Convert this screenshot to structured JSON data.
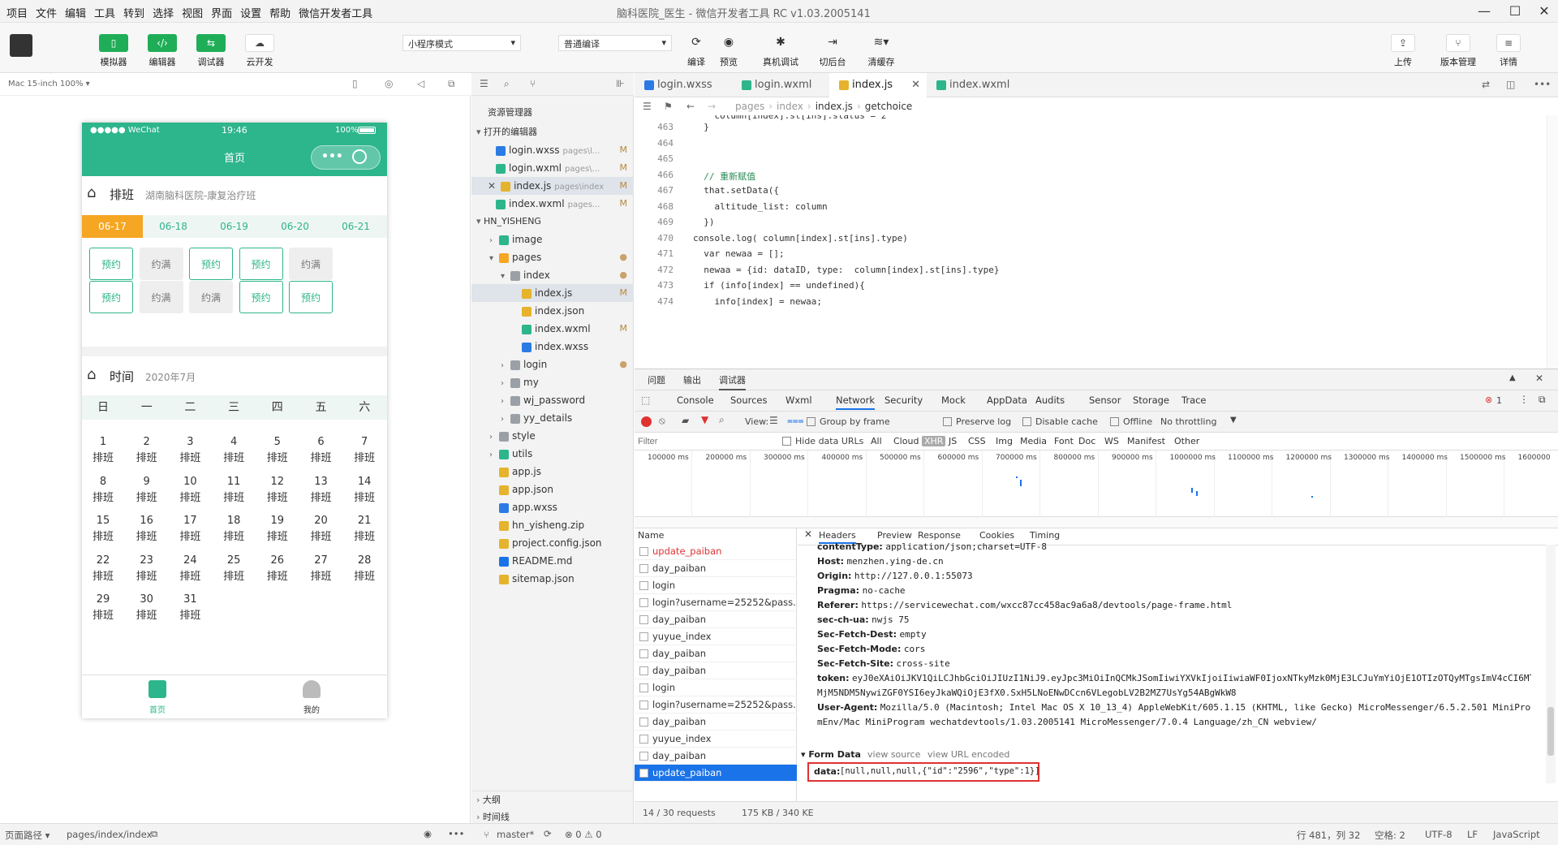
{
  "menus": [
    "项目",
    "文件",
    "编辑",
    "工具",
    "转到",
    "选择",
    "视图",
    "界面",
    "设置",
    "帮助",
    "微信开发者工具"
  ],
  "window_title": "脑科医院_医生 - 微信开发者工具 RC v1.03.2005141",
  "toolbar": {
    "simulator": "模拟器",
    "editor": "编辑器",
    "debugger": "调试器",
    "cloud": "云开发",
    "mode_select": "小程序模式",
    "compile_select": "普通编译",
    "compile": "编译",
    "preview": "预览",
    "real_debug": "真机调试",
    "background": "切后台",
    "clear_cache": "清缓存",
    "upload": "上传",
    "version": "版本管理",
    "details": "详情"
  },
  "sim": {
    "device": "Mac 15-inch 100% ▾",
    "status_carrier": "●●●●● WeChat",
    "status_time": "19:46",
    "status_battery": "100%",
    "nav_title": "首页",
    "section1_title": "排班",
    "section1_sub": "湖南脑科医院-康复治疗班",
    "dates": [
      "06-17",
      "06-18",
      "06-19",
      "06-20",
      "06-21"
    ],
    "slots_row1": [
      "预约",
      "约满",
      "预约",
      "预约",
      "约满"
    ],
    "slots_row2": [
      "预约",
      "约满",
      "约满",
      "预约",
      "预约"
    ],
    "section2_title": "时间",
    "section2_sub": "2020年7月",
    "weekdays": [
      "日",
      "一",
      "二",
      "三",
      "四",
      "五",
      "六"
    ],
    "days": [
      "1",
      "2",
      "3",
      "4",
      "5",
      "6",
      "7",
      "8",
      "9",
      "10",
      "11",
      "12",
      "13",
      "14",
      "15",
      "16",
      "17",
      "18",
      "19",
      "20",
      "21",
      "22",
      "23",
      "24",
      "25",
      "26",
      "27",
      "28",
      "29",
      "30",
      "31"
    ],
    "day_label": "排班",
    "tab_home": "首页",
    "tab_mine": "我的"
  },
  "explorer": {
    "title": "资源管理器",
    "open_editors": "打开的编辑器",
    "open_files": [
      {
        "name": "login.wxss",
        "path": "pages\\l...",
        "mod": "M",
        "color": "#2c7be5"
      },
      {
        "name": "login.wxml",
        "path": "pages\\...",
        "mod": "M",
        "color": "#2db58b"
      },
      {
        "name": "index.js",
        "path": "pages\\index",
        "mod": "M",
        "color": "#e5b32c"
      },
      {
        "name": "index.wxml",
        "path": "pages...",
        "mod": "M",
        "color": "#2db58b"
      }
    ],
    "project": "HN_YISHENG",
    "tree": [
      {
        "name": "image",
        "indent": 1,
        "type": "folder-green"
      },
      {
        "name": "pages",
        "indent": 1,
        "type": "folder-orange",
        "dot": "●"
      },
      {
        "name": "index",
        "indent": 2,
        "type": "folder",
        "dot": "●"
      },
      {
        "name": "index.js",
        "indent": 3,
        "type": "js",
        "mod": "M"
      },
      {
        "name": "index.json",
        "indent": 3,
        "type": "json"
      },
      {
        "name": "index.wxml",
        "indent": 3,
        "type": "wxml",
        "mod": "M"
      },
      {
        "name": "index.wxss",
        "indent": 3,
        "type": "wxss"
      },
      {
        "name": "login",
        "indent": 2,
        "type": "folder",
        "dot": "●"
      },
      {
        "name": "my",
        "indent": 2,
        "type": "folder"
      },
      {
        "name": "wj_password",
        "indent": 2,
        "type": "folder"
      },
      {
        "name": "yy_details",
        "indent": 2,
        "type": "folder"
      },
      {
        "name": "style",
        "indent": 1,
        "type": "folder"
      },
      {
        "name": "utils",
        "indent": 1,
        "type": "folder-green"
      },
      {
        "name": "app.js",
        "indent": 1,
        "type": "js"
      },
      {
        "name": "app.json",
        "indent": 1,
        "type": "json"
      },
      {
        "name": "app.wxss",
        "indent": 1,
        "type": "wxss"
      },
      {
        "name": "hn_yisheng.zip",
        "indent": 1,
        "type": "zip"
      },
      {
        "name": "project.config.json",
        "indent": 1,
        "type": "json"
      },
      {
        "name": "README.md",
        "indent": 1,
        "type": "md"
      },
      {
        "name": "sitemap.json",
        "indent": 1,
        "type": "json"
      }
    ],
    "outline": "大纲",
    "timeline": "时间线"
  },
  "editor": {
    "tabs": [
      "login.wxss",
      "login.wxml",
      "index.js",
      "index.wxml"
    ],
    "breadcrumb": [
      "pages",
      "index",
      "index.js",
      "getchoice"
    ],
    "lines": [
      {
        "n": "463",
        "t": "  }"
      },
      {
        "n": "464",
        "t": ""
      },
      {
        "n": "465",
        "t": ""
      },
      {
        "n": "466",
        "t": "  // 重新赋值"
      },
      {
        "n": "467",
        "t": "  that.setData({"
      },
      {
        "n": "468",
        "t": "    altitude_list: column"
      },
      {
        "n": "469",
        "t": "  })"
      },
      {
        "n": "470",
        "t": "console.log( column[index].st[ins].type)"
      },
      {
        "n": "471",
        "t": "  var newaa = [];"
      },
      {
        "n": "472",
        "t": "  newaa = {id: dataID, type:  column[index].st[ins].type}"
      },
      {
        "n": "473",
        "t": "  if (info[index] == undefined){"
      },
      {
        "n": "474",
        "t": "    info[index] = newaa;"
      }
    ]
  },
  "devtools": {
    "top_tabs": [
      "问题",
      "输出",
      "调试器"
    ],
    "tabs": [
      "Console",
      "Sources",
      "Wxml",
      "Network",
      "Security",
      "Mock",
      "AppData",
      "Audits",
      "Sensor",
      "Storage",
      "Trace"
    ],
    "error_count": "1",
    "view_label": "View:",
    "group_by_frame": "Group by frame",
    "preserve_log": "Preserve log",
    "disable_cache": "Disable cache",
    "offline": "Offline",
    "throttling": "No throttling",
    "filter_placeholder": "Filter",
    "hide_data_urls": "Hide data URLs",
    "type_filters": [
      "All",
      "Cloud",
      "XHR",
      "JS",
      "CSS",
      "Img",
      "Media",
      "Font",
      "Doc",
      "WS",
      "Manifest",
      "Other"
    ],
    "timeline_ticks": [
      "100000 ms",
      "200000 ms",
      "300000 ms",
      "400000 ms",
      "500000 ms",
      "600000 ms",
      "700000 ms",
      "800000 ms",
      "900000 ms",
      "1000000 ms",
      "1100000 ms",
      "1200000 ms",
      "1300000 ms",
      "1400000 ms",
      "1500000 ms",
      "1600000"
    ],
    "name_header": "Name",
    "requests": [
      "update_paiban",
      "day_paiban",
      "login",
      "login?username=25252&pass...",
      "day_paiban",
      "yuyue_index",
      "day_paiban",
      "day_paiban",
      "login",
      "login?username=25252&pass...",
      "day_paiban",
      "yuyue_index",
      "day_paiban",
      "update_paiban"
    ],
    "detail_tabs": [
      "Headers",
      "Preview",
      "Response",
      "Cookies",
      "Timing"
    ],
    "headers": [
      {
        "k": "contentType:",
        "v": "application/json;charset=UTF-8"
      },
      {
        "k": "Host:",
        "v": "menzhen.ying-de.cn"
      },
      {
        "k": "Origin:",
        "v": "http://127.0.0.1:55073"
      },
      {
        "k": "Pragma:",
        "v": "no-cache"
      },
      {
        "k": "Referer:",
        "v": "https://servicewechat.com/wxcc87cc458ac9a6a8/devtools/page-frame.html"
      },
      {
        "k": "sec-ch-ua:",
        "v": "nwjs 75"
      },
      {
        "k": "Sec-Fetch-Dest:",
        "v": "empty"
      },
      {
        "k": "Sec-Fetch-Mode:",
        "v": "cors"
      },
      {
        "k": "Sec-Fetch-Site:",
        "v": "cross-site"
      },
      {
        "k": "token:",
        "v": "eyJ0eXAiOiJKV1QiLCJhbGciOiJIUzI1NiJ9.eyJpc3MiOiInQCMkJSomIiwiYXVkIjoiIiwiaWF0IjoxNTkyMzk0MjE3LCJuYmYiOjE1OTIzOTQyMTgsImV4cCI6MTU5"
      },
      {
        "k": "",
        "v": "MjM5NDM5NywiZGF0YSI6eyJkaWQiOjE3fX0.SxH5LNoENwDCcn6VLegobLV2B2MZ7UsYg54ABgWkW8"
      },
      {
        "k": "User-Agent:",
        "v": "Mozilla/5.0 (Macintosh; Intel Mac OS X 10_13_4) AppleWebKit/605.1.15 (KHTML, like Gecko) MicroMessenger/6.5.2.501 MiniProgra"
      },
      {
        "k": "",
        "v": "mEnv/Mac MiniProgram wechatdevtools/1.03.2005141 MicroMessenger/7.0.4 Language/zh_CN webview/"
      }
    ],
    "form_data_title": "▾ Form Data",
    "view_source": "view source",
    "view_url_encoded": "view URL encoded",
    "form_data_key": "data:",
    "form_data_value": "[null,null,null,{\"id\":\"2596\",\"type\":1}]",
    "summary_requests": "14 / 30 requests",
    "summary_size": "175 KB / 340 KE"
  },
  "statusbar": {
    "page_path_label": "页面路径 ▾",
    "page_path": "pages/index/index",
    "branch": "master*",
    "problems": "⊗ 0 ⚠ 0",
    "cursor": "行 481，列 32",
    "spaces": "空格: 2",
    "encoding": "UTF-8",
    "eol": "LF",
    "language": "JavaScript"
  }
}
